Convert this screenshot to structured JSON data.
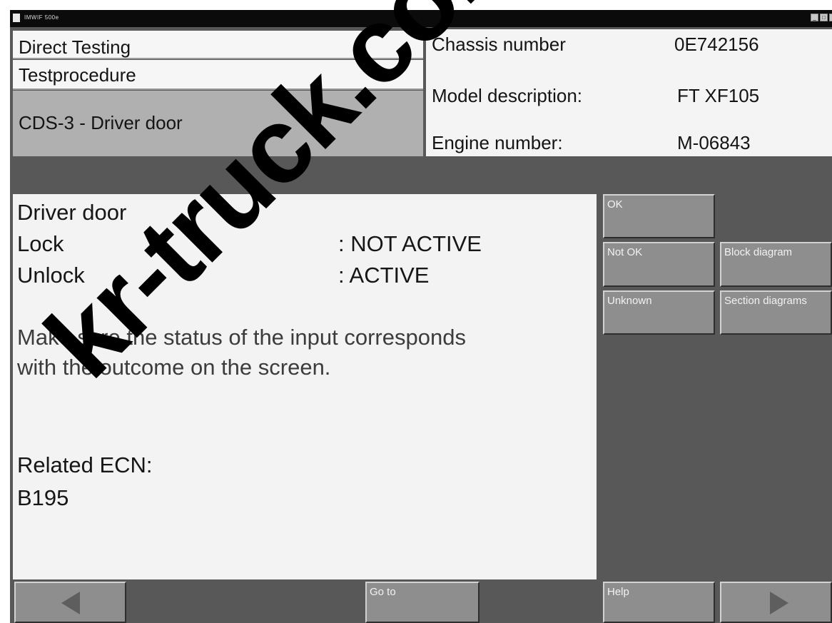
{
  "window": {
    "title": "IMWIF 500e",
    "controls": {
      "minimize": "_",
      "maximize": "□",
      "close": "x"
    }
  },
  "breadcrumb": {
    "level1": "Direct Testing",
    "level2": "Testprocedure",
    "level3": "CDS-3 - Driver door"
  },
  "vehicle": {
    "chassis_label": "Chassis number",
    "chassis_value": "0E742156",
    "model_label": "Model description:",
    "model_value": "FT XF105",
    "engine_label": "Engine number:",
    "engine_value": "M-06843"
  },
  "content": {
    "heading": "Driver door",
    "lock_label": "Lock",
    "lock_status": ": NOT ACTIVE",
    "unlock_label": "Unlock",
    "unlock_status": ": ACTIVE",
    "instruction_line1": "Make sure the status of the input corresponds",
    "instruction_line2": "with the outcome on the screen.",
    "related_label": "Related ECN:",
    "related_value": "B195"
  },
  "side_buttons": {
    "ok": "OK",
    "not_ok": "Not OK",
    "block_diagram": "Block diagram",
    "unknown": "Unknown",
    "section_diagrams": "Section diagrams"
  },
  "nav": {
    "back_icon": "left-arrow-icon",
    "goto": "Go to",
    "help": "Help",
    "next_icon": "right-arrow-icon"
  },
  "watermark": "kr-truck.com.ua",
  "colors": {
    "background": "#585858",
    "panel": "#f3f3f3",
    "active_crumb": "#b0b0b0",
    "button": "#8e8e8e",
    "titlebar": "#0b0b0b"
  }
}
